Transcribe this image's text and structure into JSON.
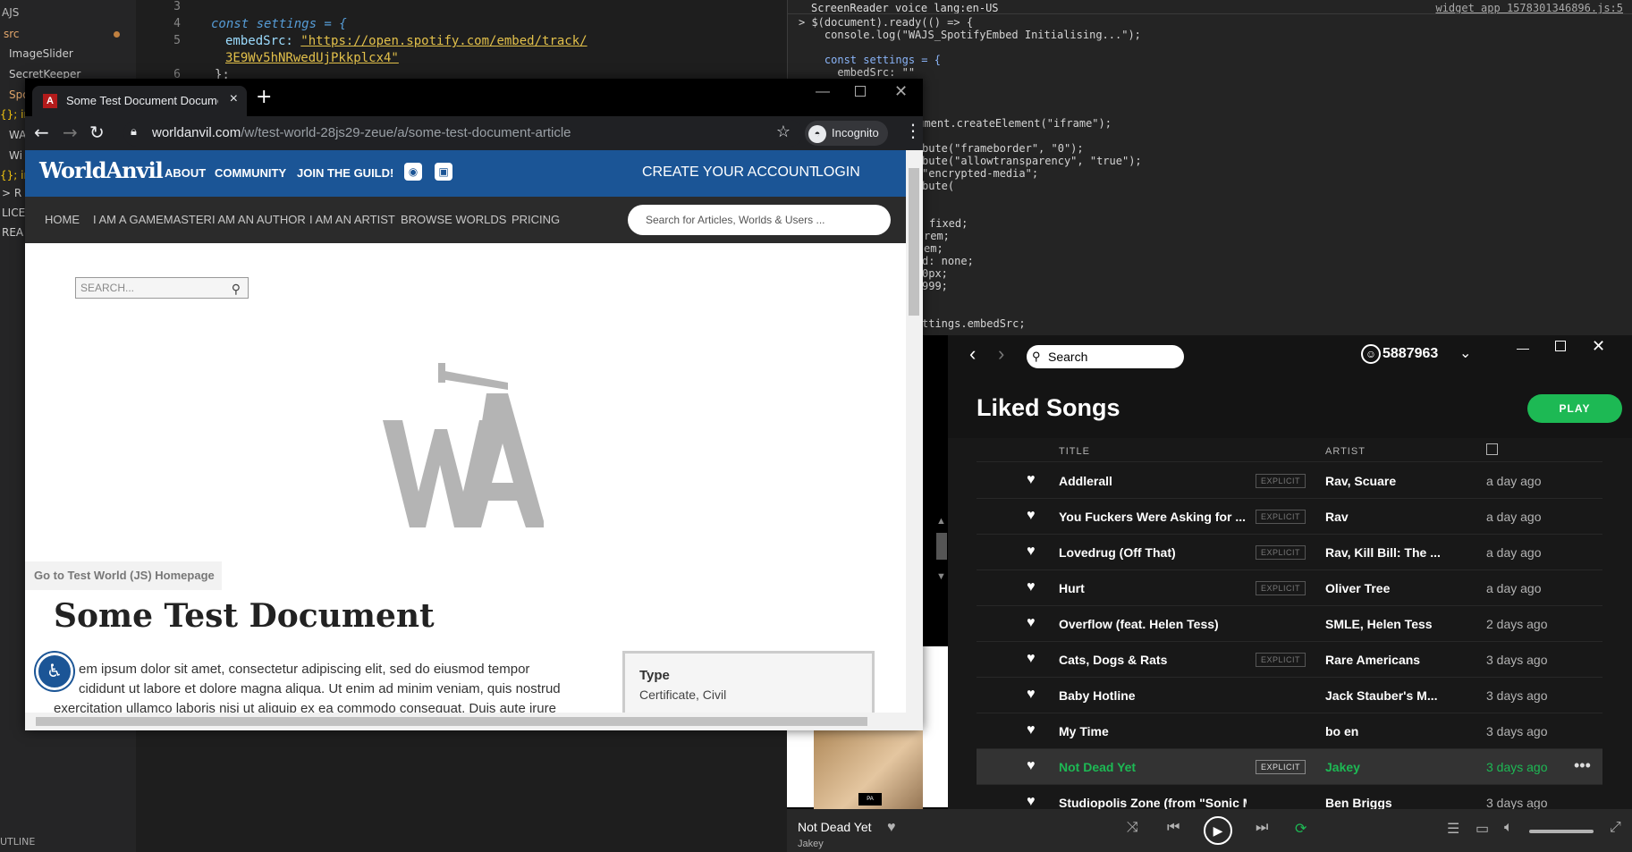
{
  "vscode": {
    "sidebar": [
      "AJS",
      "src",
      "ImageSlider",
      "SecretKeeper",
      "Spo",
      "{}; in",
      "WA",
      "Wi",
      "{}; in",
      "> R",
      "LICE",
      "REA"
    ],
    "outline_label": "UTLINE",
    "line_numbers": [
      "3",
      "4",
      "5",
      "6"
    ],
    "code": {
      "l4": "const settings = {",
      "l5a": "embedSrc: ",
      "l5b": "\"https://open.spotify.com/embed/track/",
      "l5c": "3E9Wv5hNRwedUjPkkplcx4\"",
      "l6": "};"
    }
  },
  "devtools": {
    "header": "ScreenReader voice lang:en-US",
    "source_link": "widget_app_1578301346896.js:5",
    "lines": [
      "> $(document).ready(() => {",
      "    console.log(\"WAJS_SpotifyEmbed Initialising...\");",
      "",
      "    const settings = {",
      "      embedSrc: \"\""
    ],
    "fragments": [
      "cument.createElement(\"iframe\");",
      "bute(\"frameborder\", \"0\");",
      "bute(\"allowtransparency\", \"true\");",
      "\"encrypted-media\";",
      "bute(",
      "fixed;",
      "rem;",
      "em;",
      "d: none;",
      "0px;",
      "999;",
      "ttings.embedSrc;"
    ]
  },
  "chrome": {
    "tab_title": "Some Test Document Document",
    "url_host": "worldanvil.com",
    "url_path": "/w/test-world-28js29-zeue/a/some-test-document-article",
    "incognito_label": "Incognito"
  },
  "worldanvil": {
    "logo": "WorldAnvil",
    "top_nav": [
      "ABOUT",
      "COMMUNITY",
      "JOIN THE GUILD!"
    ],
    "right_nav": [
      "CREATE YOUR ACCOUNT",
      "LOGIN"
    ],
    "sub_nav": [
      "HOME",
      "I AM A GAMEMASTER",
      "I AM AN AUTHOR",
      "I AM AN ARTIST",
      "BROWSE WORLDS",
      "PRICING"
    ],
    "search_placeholder": "Search for Articles, Worlds & Users ...",
    "content_search": "SEARCH...",
    "world_link": "Go to Test World (JS) Homepage",
    "doc_title": "Some Test Document",
    "lorem_1": "em ipsum dolor sit amet, consectetur adipiscing elit, sed do eiusmod tempor",
    "lorem_2": "cididunt ut labore et dolore magna aliqua. Ut enim ad minim veniam, quis nostrud",
    "lorem_3": "exercitation ullamco laboris nisi ut aliquip ex ea commodo consequat. Duis aute irure",
    "type_label": "Type",
    "type_value": "Certificate, Civil"
  },
  "spotify": {
    "search_placeholder": "Search",
    "user": "5887963",
    "title": "Liked Songs",
    "play_label": "PLAY",
    "col_title": "TITLE",
    "col_artist": "ARTIST",
    "explicit_label": "EXPLICIT",
    "tracks": [
      {
        "title": "Addlerall",
        "explicit": true,
        "artist": "Rav, Scuare",
        "date": "a day ago"
      },
      {
        "title": "You Fuckers Were Asking for ...",
        "explicit": true,
        "artist": "Rav",
        "date": "a day ago"
      },
      {
        "title": "Lovedrug (Off That)",
        "explicit": true,
        "artist": "Rav, Kill Bill: The ...",
        "date": "a day ago"
      },
      {
        "title": "Hurt",
        "explicit": true,
        "artist": "Oliver Tree",
        "date": "a day ago"
      },
      {
        "title": "Overflow (feat. Helen Tess)",
        "explicit": false,
        "artist": "SMLE, Helen Tess",
        "date": "2 days ago"
      },
      {
        "title": "Cats, Dogs & Rats",
        "explicit": true,
        "artist": "Rare Americans",
        "date": "3 days ago"
      },
      {
        "title": "Baby Hotline",
        "explicit": false,
        "artist": "Jack Stauber's M...",
        "date": "3 days ago"
      },
      {
        "title": "My Time",
        "explicit": false,
        "artist": "bo en",
        "date": "3 days ago"
      },
      {
        "title": "Not Dead Yet",
        "explicit": true,
        "artist": "Jakey",
        "date": "3 days ago",
        "selected": true
      },
      {
        "title": "Studiopolis Zone (from \"Sonic Mania\")",
        "explicit": false,
        "artist": "Ben Briggs",
        "date": "3 days ago"
      }
    ],
    "now_playing_title": "Not Dead Yet",
    "now_playing_artist": "Jakey",
    "accent": "#1db954"
  }
}
